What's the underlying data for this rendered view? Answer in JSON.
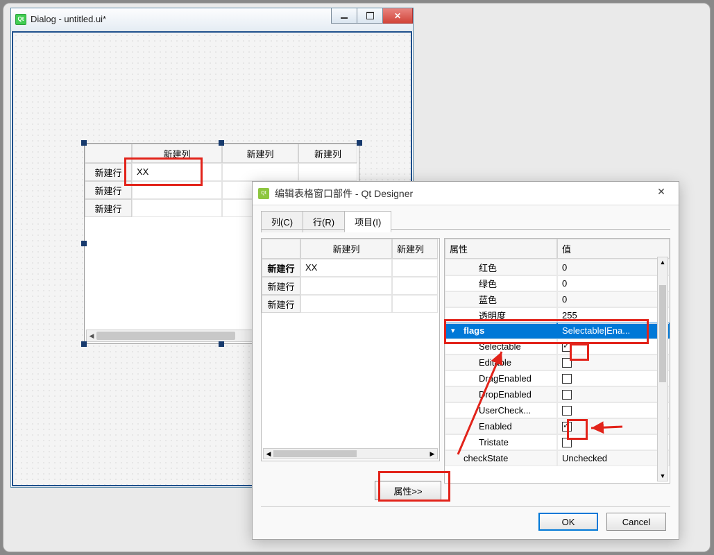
{
  "main_window": {
    "title": "Dialog - untitled.ui*"
  },
  "table_widget": {
    "col_headers": [
      "新建列",
      "新建列",
      "新建列"
    ],
    "row_headers": [
      "新建行",
      "新建行",
      "新建行"
    ],
    "cells": {
      "r0c0": "XX"
    }
  },
  "modal": {
    "title": "编辑表格窗口部件 - Qt Designer",
    "tabs": {
      "cols": "列(C)",
      "rows": "行(R)",
      "items": "项目(I)"
    },
    "active_tab": "items",
    "left_table": {
      "col_headers": [
        "新建列",
        "新建列"
      ],
      "row_headers": [
        "新建行",
        "新建行",
        "新建行"
      ],
      "cells": {
        "r0c0": "XX"
      }
    },
    "prop_header": {
      "name": "属性",
      "value": "值"
    },
    "props": {
      "red": {
        "label": "红色",
        "value": "0"
      },
      "green": {
        "label": "绿色",
        "value": "0"
      },
      "blue": {
        "label": "蓝色",
        "value": "0"
      },
      "alpha": {
        "label": "透明度",
        "value": "255"
      },
      "flags": {
        "label": "flags",
        "value": "Selectable|Ena..."
      },
      "selectable": {
        "label": "Selectable",
        "checked": true
      },
      "editable": {
        "label": "Editable",
        "checked": false
      },
      "dragenabled": {
        "label": "DragEnabled",
        "checked": false
      },
      "dropenabled": {
        "label": "DropEnabled",
        "checked": false
      },
      "usercheck": {
        "label": "UserCheck...",
        "checked": false
      },
      "enabled": {
        "label": "Enabled",
        "checked": true
      },
      "tristate": {
        "label": "Tristate",
        "checked": false
      },
      "checkstate": {
        "label": "checkState",
        "value": "Unchecked"
      }
    },
    "prop_btn": "属性>>",
    "ok": "OK",
    "cancel": "Cancel"
  }
}
